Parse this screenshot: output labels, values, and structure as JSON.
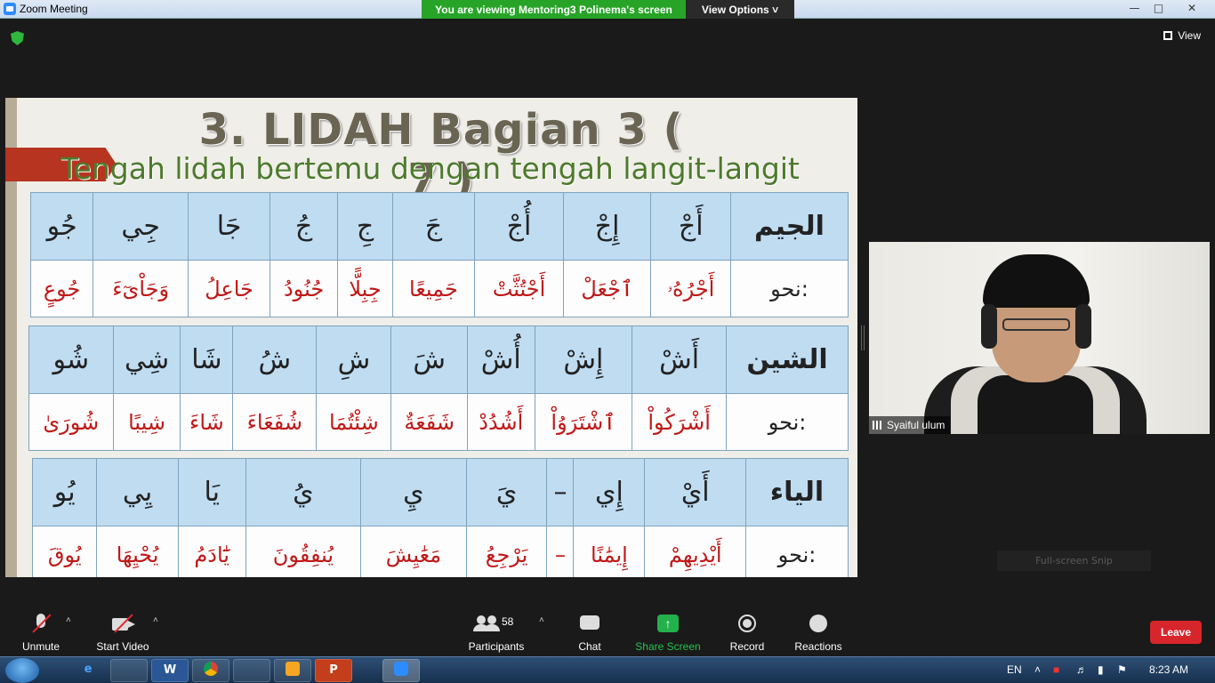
{
  "window": {
    "title": "Zoom Meeting"
  },
  "share_banner": "You are viewing Mentoring3 Polinema's screen",
  "view_options": "View Options",
  "view_button": "View",
  "slide": {
    "title": "3. LIDAH Bagian 3 ( 7 )",
    "subtitle": "Tengah lidah bertemu dengan tengah langit-langit",
    "rows": [
      {
        "label": "الجيم",
        "letters": [
          "جُو",
          "جِي",
          "جَا",
          "جُ",
          "جِ",
          "جَ",
          "أُجْ",
          "إِجْ",
          "أَجْ"
        ],
        "examples_label": "نحو:",
        "examples": [
          "جُوعٍ",
          "وَجَاْىٓءَ",
          "جَاعِلُ",
          "جُنُودُ",
          "جِبِلًّا",
          "جَمِيعًا",
          "أَجْتُثَّتْ",
          "ٱجْعَلْ",
          "أَجْرُهُۥ"
        ]
      },
      {
        "label": "الشين",
        "letters": [
          "شُو",
          "شِي",
          "شَا",
          "شُ",
          "شِ",
          "شَ",
          "أُشْ",
          "إِشْ",
          "أَشْ"
        ],
        "examples_label": "نحو:",
        "examples": [
          "شُورَىٰ",
          "شِيبًا",
          "شَاءَ",
          "شُفَعَاءَ",
          "شِئْتُمَا",
          "شَفَعَةٌ",
          "أَشُدُدْ",
          "ٱشْتَرَوُاْ",
          "أَشْرَكُواْ"
        ]
      },
      {
        "label": "الياء",
        "letters": [
          "يُو",
          "يِي",
          "يَا",
          "يُ",
          "يِ",
          "يَ",
          "–",
          "إِي",
          "أَيْ"
        ],
        "examples_label": "نحو:",
        "examples": [
          "يُوقَ",
          "يُحْيِهَا",
          "يَٰٓادَمُ",
          "يُنفِقُونَ",
          "مَعَٰيِشَ",
          "يَرْجِعُ",
          "–",
          "إِيمَٰنًا",
          "أَيْدِيهِمْ"
        ]
      }
    ]
  },
  "participant": {
    "name": "Syaiful ulum"
  },
  "snip_label": "Full-screen Snip",
  "toolbar": {
    "unmute": "Unmute",
    "start_video": "Start Video",
    "participants": "Participants",
    "participants_count": "58",
    "chat": "Chat",
    "share_screen": "Share Screen",
    "record": "Record",
    "reactions": "Reactions",
    "leave": "Leave"
  },
  "taskbar": {
    "language": "EN",
    "time": "8:23 AM",
    "apps": [
      "ie",
      "explorer",
      "word",
      "chrome",
      "files",
      "app",
      "powerpoint",
      "zoom"
    ],
    "word_glyph": "W",
    "ppt_glyph": "P"
  }
}
